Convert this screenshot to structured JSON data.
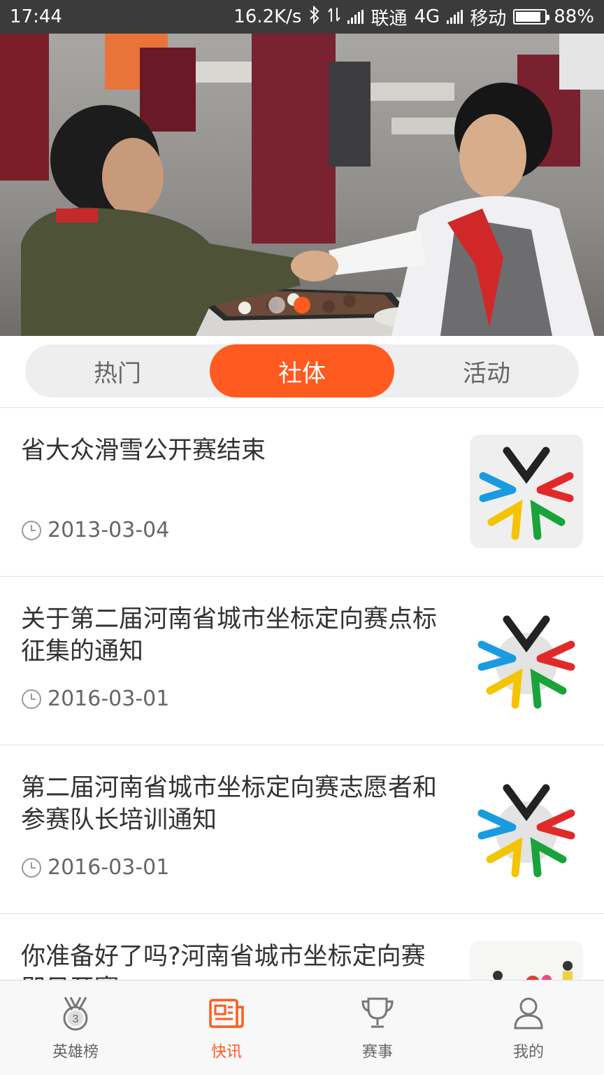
{
  "status_bar": {
    "time": "17:44",
    "speed": "16.2K/s",
    "carrier1": "联通",
    "network": "4G",
    "carrier2": "移动",
    "battery": "88%",
    "battery_level": 0.88
  },
  "banner": {
    "image_icon": "banner-photo",
    "page_indicator": {
      "count": 2,
      "active": 1
    }
  },
  "segments": [
    {
      "label": "热门"
    },
    {
      "label": "社体"
    },
    {
      "label": "活动"
    }
  ],
  "segment_active": 1,
  "news": [
    {
      "title": "省大众滑雪公开赛结束",
      "date": "2013-03-04",
      "thumb": "sports-logo"
    },
    {
      "title": "关于第二届河南省城市坐标定向赛点标征集的通知",
      "date": "2016-03-01",
      "thumb": "sports-logo"
    },
    {
      "title": "第二届河南省城市坐标定向赛志愿者和参赛队长培训通知",
      "date": "2016-03-01",
      "thumb": "sports-logo"
    },
    {
      "title": "你准备好了吗?河南省城市坐标定向赛即日开赛",
      "date": "",
      "thumb": "runners-photo"
    }
  ],
  "tabbar": [
    {
      "label": "英雄榜",
      "icon": "medal-icon"
    },
    {
      "label": "快讯",
      "icon": "news-icon"
    },
    {
      "label": "赛事",
      "icon": "trophy-icon"
    },
    {
      "label": "我的",
      "icon": "user-icon"
    }
  ],
  "tab_active": 1,
  "colors": {
    "accent": "#ff5a1f",
    "status_bar": "#3b3b3b"
  }
}
